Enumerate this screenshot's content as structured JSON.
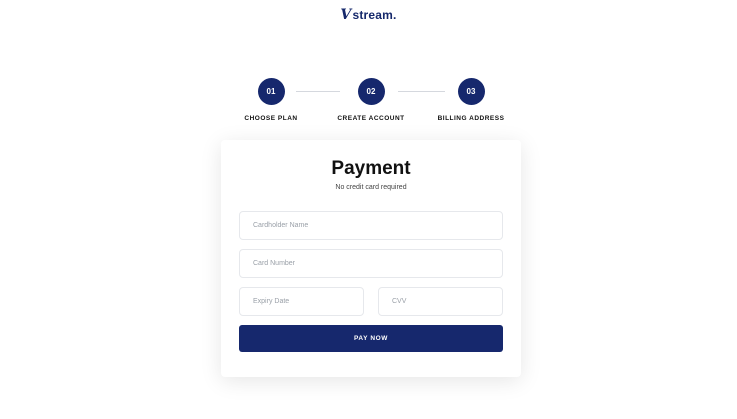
{
  "logo": {
    "mark": "V",
    "text": "stream."
  },
  "steps": [
    {
      "number": "01",
      "label": "CHOOSE PLAN"
    },
    {
      "number": "02",
      "label": "CREATE ACCOUNT"
    },
    {
      "number": "03",
      "label": "BILLING ADDRESS"
    }
  ],
  "card": {
    "title": "Payment",
    "subtitle": "No credit card required",
    "fields": {
      "cardholder_placeholder": "Cardholder Name",
      "card_number_placeholder": "Card Number",
      "expiry_placeholder": "Expiry Date",
      "cvv_placeholder": "CVV"
    },
    "pay_button": "PAY NOW"
  },
  "colors": {
    "brand": "#16286d",
    "background": "#ffffff",
    "field_border": "#e6e8ec"
  }
}
